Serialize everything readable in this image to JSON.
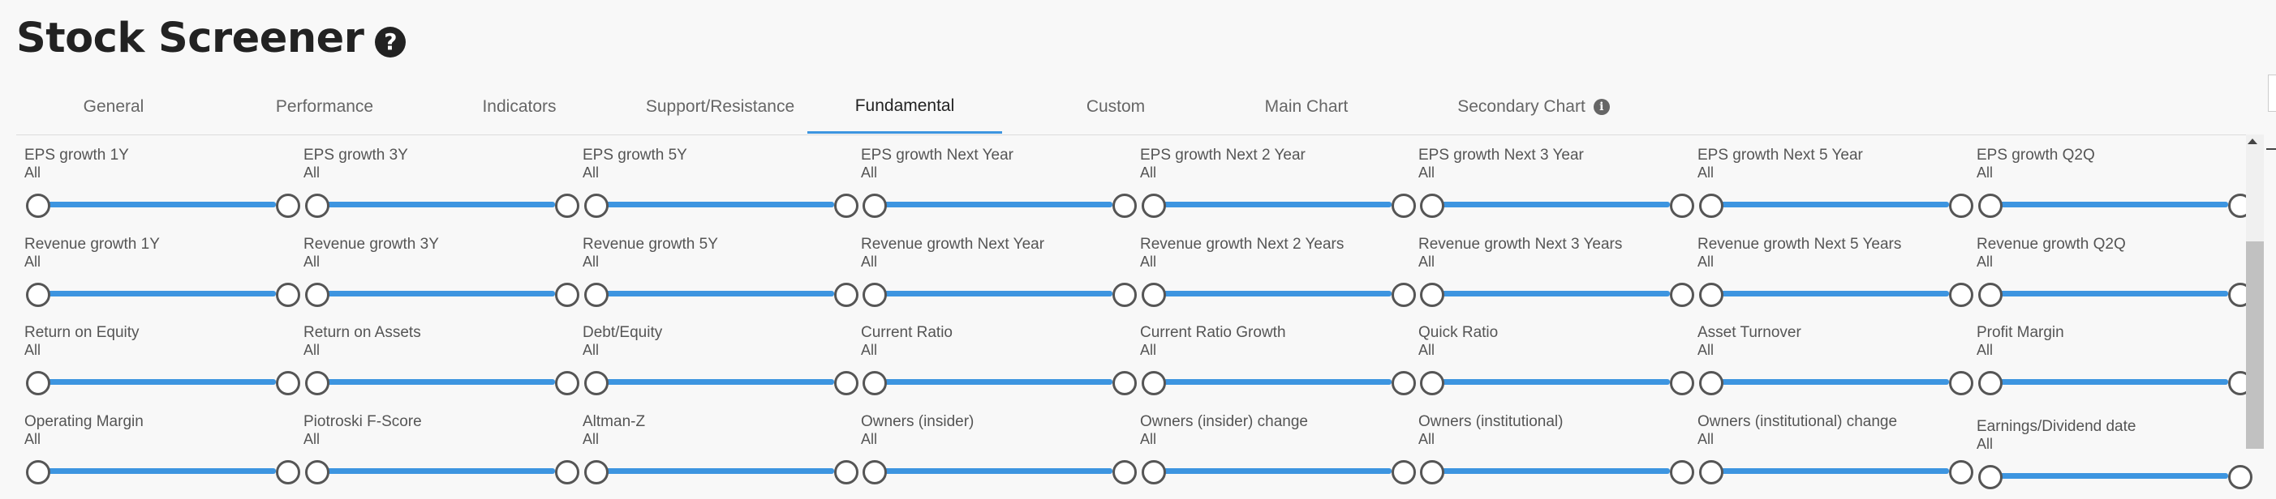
{
  "page": {
    "title": "Stock Screener",
    "help_glyph": "?"
  },
  "tabs": [
    {
      "label": "General",
      "active": false
    },
    {
      "label": "Performance",
      "active": false
    },
    {
      "label": "Indicators",
      "active": false
    },
    {
      "label": "Support/Resistance",
      "active": false
    },
    {
      "label": "Fundamental",
      "active": true
    },
    {
      "label": "Custom",
      "active": false
    },
    {
      "label": "Main Chart",
      "active": false
    },
    {
      "label": "Secondary Chart",
      "active": false,
      "info_glyph": "i"
    }
  ],
  "filters": [
    [
      {
        "label": "EPS growth 1Y",
        "value": "All"
      },
      {
        "label": "EPS growth 3Y",
        "value": "All"
      },
      {
        "label": "EPS growth 5Y",
        "value": "All"
      },
      {
        "label": "EPS growth Next Year",
        "value": "All"
      },
      {
        "label": "EPS growth Next 2 Year",
        "value": "All"
      },
      {
        "label": "EPS growth Next 3 Year",
        "value": "All"
      },
      {
        "label": "EPS growth Next 5 Year",
        "value": "All"
      },
      {
        "label": "EPS growth Q2Q",
        "value": "All"
      }
    ],
    [
      {
        "label": "Revenue growth 1Y",
        "value": "All"
      },
      {
        "label": "Revenue growth 3Y",
        "value": "All"
      },
      {
        "label": "Revenue growth 5Y",
        "value": "All"
      },
      {
        "label": "Revenue growth Next Year",
        "value": "All"
      },
      {
        "label": "Revenue growth Next 2 Years",
        "value": "All"
      },
      {
        "label": "Revenue growth Next 3 Years",
        "value": "All"
      },
      {
        "label": "Revenue growth Next 5 Years",
        "value": "All"
      },
      {
        "label": "Revenue growth Q2Q",
        "value": "All"
      }
    ],
    [
      {
        "label": "Return on Equity",
        "value": "All"
      },
      {
        "label": "Return on Assets",
        "value": "All"
      },
      {
        "label": "Debt/Equity",
        "value": "All"
      },
      {
        "label": "Current Ratio",
        "value": "All"
      },
      {
        "label": "Current Ratio Growth",
        "value": "All"
      },
      {
        "label": "Quick Ratio",
        "value": "All"
      },
      {
        "label": "Asset Turnover",
        "value": "All"
      },
      {
        "label": "Profit Margin",
        "value": "All"
      }
    ],
    [
      {
        "label": "Operating Margin",
        "value": "All"
      },
      {
        "label": "Piotroski F-Score",
        "value": "All"
      },
      {
        "label": "Altman-Z",
        "value": "All"
      },
      {
        "label": "Owners (insider)",
        "value": "All"
      },
      {
        "label": "Owners (insider) change",
        "value": "All"
      },
      {
        "label": "Owners (institutional)",
        "value": "All"
      },
      {
        "label": "Owners (institutional) change",
        "value": "All"
      },
      {
        "label": "Earnings/Dividend date",
        "value": "All"
      }
    ]
  ],
  "colors": {
    "accent": "#3d95e0",
    "handle_border": "#555555",
    "text": "#555555"
  }
}
